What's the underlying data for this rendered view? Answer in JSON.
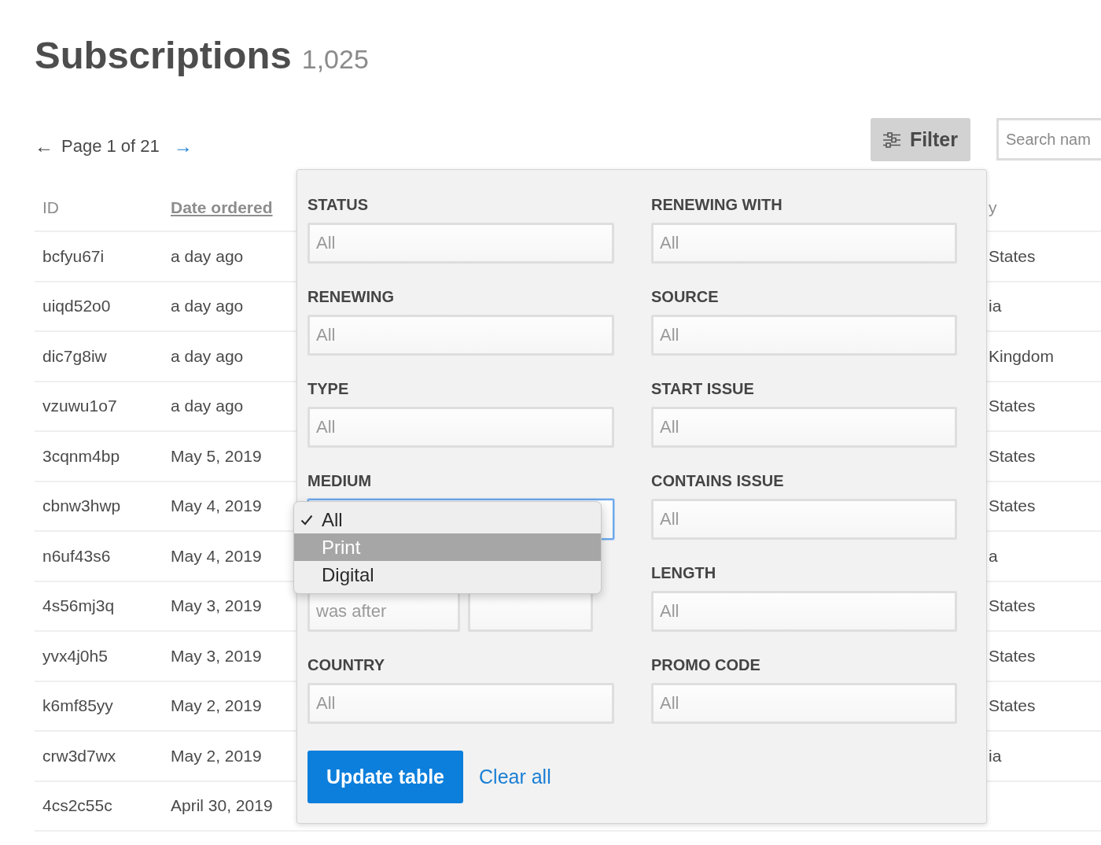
{
  "header": {
    "title": "Subscriptions",
    "count": "1,025"
  },
  "pagination": {
    "previous": {
      "symbol": "←",
      "disabled": true
    },
    "label": "Page 1 of 21",
    "next": {
      "symbol": "→",
      "disabled": false
    }
  },
  "toolbar": {
    "filter_button": "Filter",
    "search": {
      "placeholder": "Search nam"
    }
  },
  "table": {
    "columns": [
      {
        "label": "ID",
        "sorted": false
      },
      {
        "label": "Date ordered",
        "sorted": true
      },
      {
        "label": "y",
        "sorted": false
      }
    ],
    "rows": [
      [
        "bcfyu67i",
        "a day ago",
        "States"
      ],
      [
        "uiqd52o0",
        "a day ago",
        "ia"
      ],
      [
        "dic7g8iw",
        "a day ago",
        "Kingdom"
      ],
      [
        "vzuwu1o7",
        "a day ago",
        "States"
      ],
      [
        "3cqnm4bp",
        "May 5, 2019",
        "States"
      ],
      [
        "cbnw3hwp",
        "May 4, 2019",
        "States"
      ],
      [
        "n6uf43s6",
        "May 4, 2019",
        "a"
      ],
      [
        "4s56mj3q",
        "May 3, 2019",
        "States"
      ],
      [
        "yvx4j0h5",
        "May 3, 2019",
        "States"
      ],
      [
        "k6mf85yy",
        "May 2, 2019",
        "States"
      ],
      [
        "crw3d7wx",
        "May 2, 2019",
        "ia"
      ],
      [
        "4cs2c55c",
        "April 30, 2019"
      ]
    ]
  },
  "filter_panel": {
    "columns": [
      {
        "filters": [
          {
            "kind": "select",
            "label": "STATUS",
            "value": "All",
            "focused": false
          },
          {
            "kind": "select",
            "label": "RENEWING",
            "value": "All",
            "focused": false
          },
          {
            "kind": "select",
            "label": "TYPE",
            "value": "All",
            "focused": false
          },
          {
            "kind": "select",
            "label": "MEDIUM",
            "focused": true,
            "menu": [
              {
                "label": "All",
                "selected": true,
                "highlighted": false
              },
              {
                "label": "Print",
                "selected": false,
                "highlighted": true
              },
              {
                "label": "Digital",
                "selected": false,
                "highlighted": false
              }
            ]
          },
          {
            "kind": "date",
            "condition": "was after"
          },
          {
            "kind": "select",
            "label": "COUNTRY",
            "value": "All",
            "focused": false
          }
        ]
      },
      {
        "filters": [
          {
            "kind": "select",
            "label": "RENEWING WITH",
            "value": "All",
            "focused": false
          },
          {
            "kind": "select",
            "label": "SOURCE",
            "value": "All",
            "focused": false
          },
          {
            "kind": "select",
            "label": "START ISSUE",
            "value": "All",
            "focused": false
          },
          {
            "kind": "select",
            "label": "CONTAINS ISSUE",
            "value": "All",
            "focused": false
          },
          {
            "kind": "select",
            "label": "LENGTH",
            "value": "All",
            "focused": false
          },
          {
            "kind": "select",
            "label": "PROMO CODE",
            "value": "All",
            "focused": false
          }
        ]
      }
    ],
    "update_button": "Update table",
    "clear_link": "Clear all"
  }
}
